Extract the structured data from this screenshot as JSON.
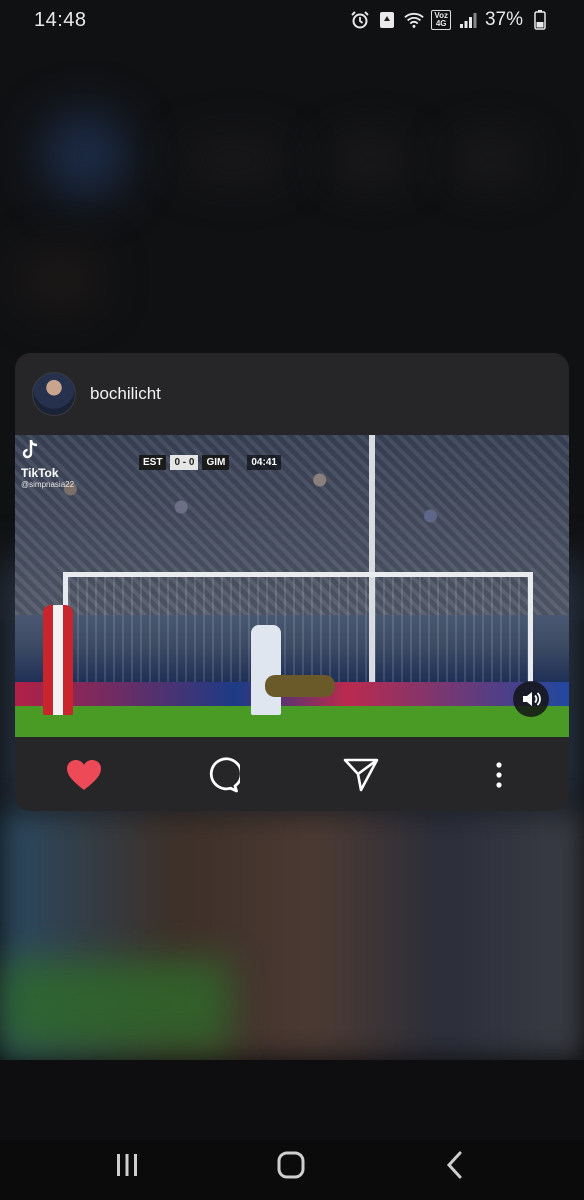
{
  "status_bar": {
    "time": "14:48",
    "battery": "37%",
    "volte_top": "Voz",
    "volte_bottom": "4G"
  },
  "post": {
    "username": "bochilicht",
    "video": {
      "watermark_brand": "TikTok",
      "watermark_handle": "@simpnasia22",
      "score_home": "EST",
      "score_value": "0 - 0",
      "score_away": "GIM",
      "clock": "04:41"
    },
    "liked": true,
    "like_color": "#ed4956"
  },
  "icons": {
    "like": "heart-icon",
    "comment": "comment-icon",
    "share": "send-icon",
    "more": "more-vertical-icon",
    "sound": "speaker-icon"
  }
}
